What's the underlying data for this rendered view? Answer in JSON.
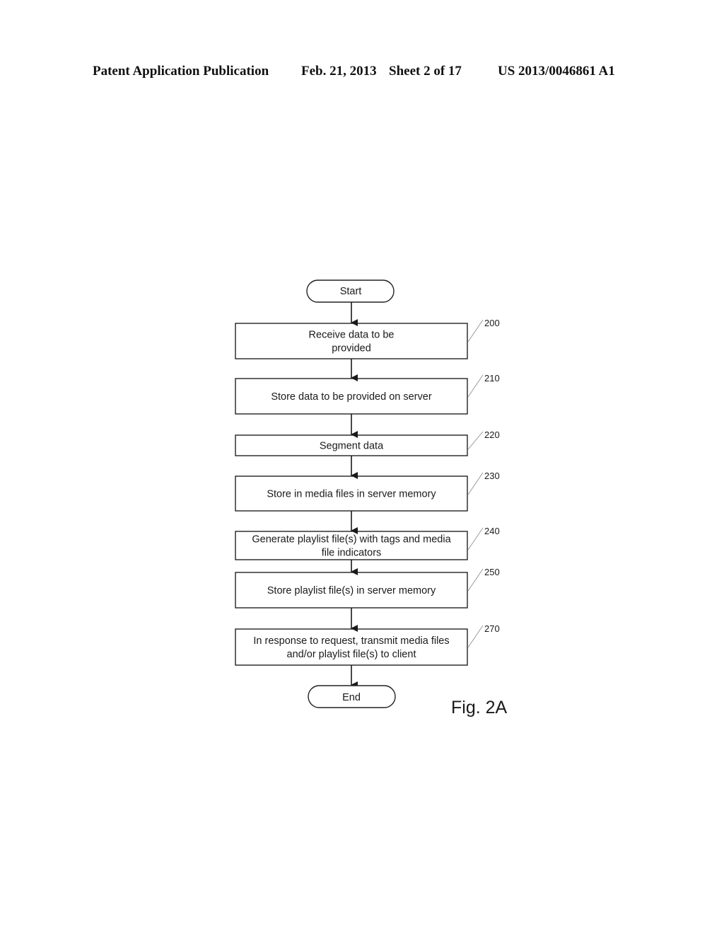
{
  "header": {
    "publication": "Patent Application Publication",
    "date": "Feb. 21, 2013",
    "sheet": "Sheet 2 of 17",
    "number": "US 2013/0046861 A1"
  },
  "figure_label": "Fig. 2A",
  "flowchart": {
    "start": "Start",
    "end": "End",
    "steps": [
      {
        "ref": "200",
        "lines": [
          "Receive data to be",
          "provided"
        ]
      },
      {
        "ref": "210",
        "lines": [
          "Store data to be provided on server"
        ]
      },
      {
        "ref": "220",
        "lines": [
          "Segment data"
        ]
      },
      {
        "ref": "230",
        "lines": [
          "Store in media files in server memory"
        ]
      },
      {
        "ref": "240",
        "lines": [
          "Generate playlist file(s) with tags and media",
          "file indicators"
        ]
      },
      {
        "ref": "250",
        "lines": [
          "Store playlist file(s) in server memory"
        ]
      },
      {
        "ref": "270",
        "lines": [
          "In response to request, transmit media files",
          "and/or playlist file(s) to client"
        ]
      }
    ]
  }
}
